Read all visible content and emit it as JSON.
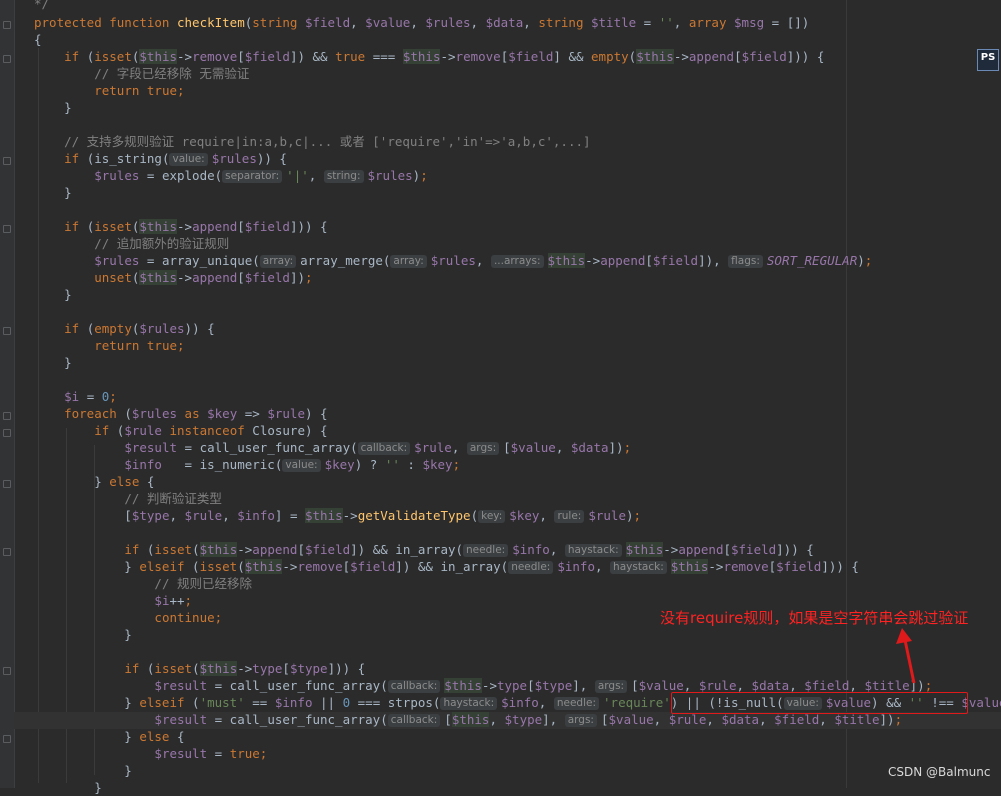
{
  "editor": {
    "language": "PHP",
    "ide_badge": "PS",
    "watermark": "CSDN @Balmunc"
  },
  "annotation": {
    "text": "没有require规则，如果是空字符串会跳过验证",
    "color": "#e0191a"
  },
  "hints": {
    "value": "value:",
    "separator": "separator:",
    "string": "string:",
    "array": "array:",
    "arrays": "...arrays:",
    "flags": "flags:",
    "callback": "callback:",
    "args": "args:",
    "key": "key:",
    "rule": "rule:",
    "needle": "needle:",
    "haystack": "haystack:"
  },
  "comments": {
    "c1": "*/",
    "c2": "// 字段已经移除 无需验证",
    "c3": "// 支持多规则验证 require|in:a,b,c|... 或者 ['require','in'=>'a,b,c',...]",
    "c4": "// 追加额外的验证规则",
    "c5": "// 判断验证类型",
    "c6": "// 规则已经移除"
  },
  "signature": {
    "fname": "checkItem",
    "params": "(string $field, $value, $rules, $data, string $title = '', array $msg = [])"
  }
}
